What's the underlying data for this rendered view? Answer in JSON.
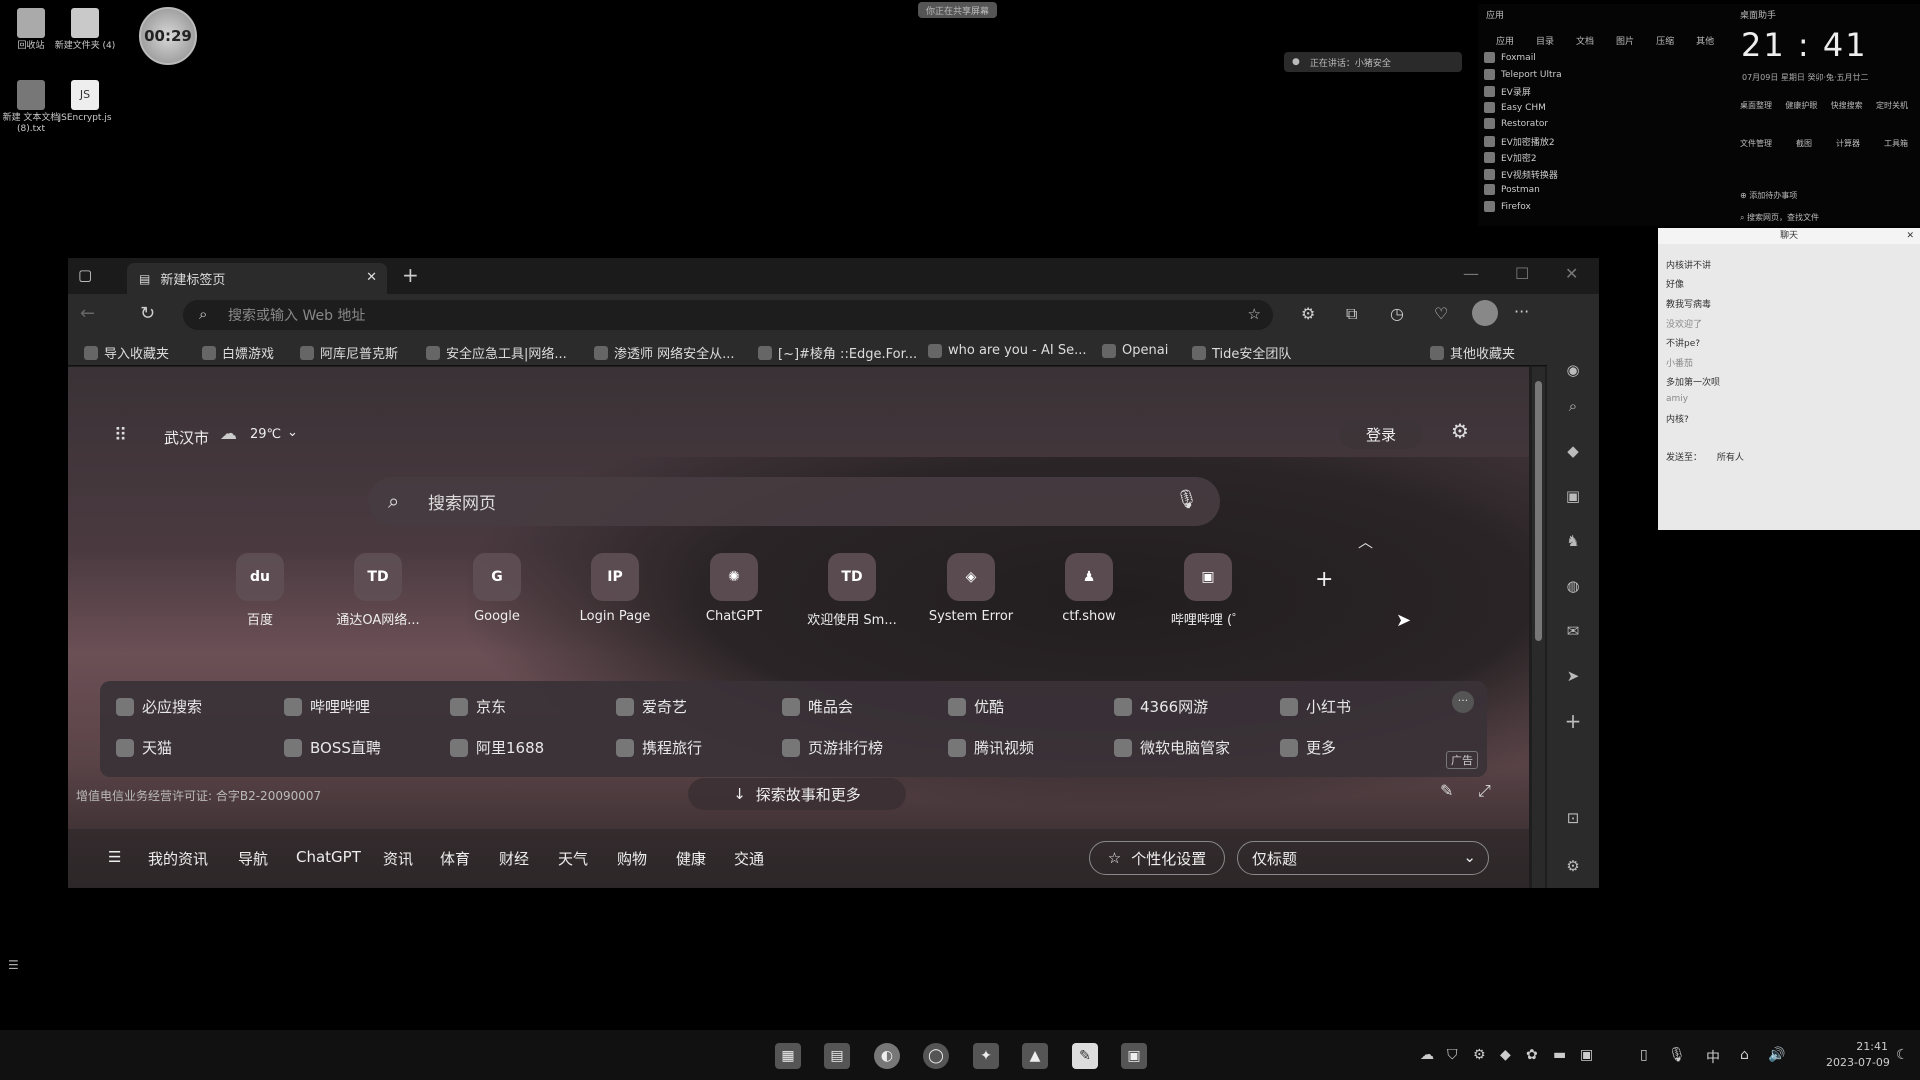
{
  "desktop": {
    "icons": [
      {
        "label": "回收站"
      },
      {
        "label": "新建文件夹 (4)"
      },
      {
        "label": "新建 文本文档 (8).txt"
      },
      {
        "label": "JSEncrypt.js"
      }
    ],
    "timer": "00:29",
    "top_notice": "你正在共享屏幕",
    "meeting_bar": "正在讲话：小猪安全"
  },
  "launcher": {
    "tabs": [
      "应用",
      "目录",
      "文档",
      "图片",
      "压缩",
      "其他"
    ],
    "header_left": "应用",
    "header_right": "桌面助手",
    "apps": [
      "Foxmail",
      "Teleport Ultra",
      "EV录屏",
      "Easy CHM",
      "Restorator",
      "EV加密播放2",
      "EV加密2",
      "EV视频转换器",
      "Postman",
      "Firefox"
    ],
    "clock": "21 : 41",
    "date_line": "07月09日   星期日   癸卯·兔·五月廿二",
    "tools_row1": [
      "桌面整理",
      "健康护眼",
      "快搜搜索",
      "定时关机"
    ],
    "tools_row2": [
      "文件管理",
      "截图",
      "计算器",
      "工具箱"
    ],
    "add_event": "添加待办事项",
    "search_hint": "搜索网页，查找文件"
  },
  "chat": {
    "title": "聊天",
    "messages": [
      "内核讲不讲",
      "好像",
      "教我写病毒",
      "没欢迎了",
      "不讲pe?",
      "小番茄",
      "多加第一次呗",
      "amiy",
      "内核?"
    ],
    "send_to_label": "发送至：",
    "send_to_value": "所有人"
  },
  "browser": {
    "tab_title": "新建标签页",
    "address_placeholder": "搜索或输入 Web 地址",
    "favorites": [
      "导入收藏夹",
      "白嫖游戏",
      "阿库尼普克斯",
      "安全应急工具|网络...",
      "渗透师 网络安全从...",
      "[~]#棱角 ::Edge.For...",
      "who are you - AI Se...",
      "Openai",
      "Tide安全团队",
      "其他收藏夹"
    ],
    "city": "武汉市",
    "temperature": "29℃",
    "login_label": "登录",
    "search_placeholder": "搜索网页",
    "quick_links": [
      {
        "label": "百度",
        "glyph": "du"
      },
      {
        "label": "通达OA网络...",
        "glyph": "TD"
      },
      {
        "label": "Google",
        "glyph": "G"
      },
      {
        "label": "Login Page",
        "glyph": "IP"
      },
      {
        "label": "ChatGPT",
        "glyph": "✺"
      },
      {
        "label": "欢迎使用 Sm...",
        "glyph": "TD"
      },
      {
        "label": "System Error",
        "glyph": "◈"
      },
      {
        "label": "ctf.show",
        "glyph": "♟"
      },
      {
        "label": "哔哩哔哩 (゜",
        "glyph": "▣"
      }
    ],
    "panel_row1": [
      "必应搜索",
      "哔哩哔哩",
      "京东",
      "爱奇艺",
      "唯品会",
      "优酷",
      "4366网游",
      "小红书"
    ],
    "panel_row2": [
      "天猫",
      "BOSS直聘",
      "阿里1688",
      "携程旅行",
      "页游排行榜",
      "腾讯视频",
      "微软电脑管家",
      "更多"
    ],
    "ad_label": "广告",
    "license": "增值电信业务经营许可证: 合字B2-20090007",
    "explore_label": "探索故事和更多",
    "news_tabs": [
      "我的资讯",
      "导航",
      "ChatGPT",
      "资讯",
      "体育",
      "财经",
      "天气",
      "购物",
      "健康",
      "交通"
    ],
    "personalize_label": "个性化设置",
    "view_select": "仅标题"
  },
  "taskbar": {
    "ime": "中",
    "time": "21:41",
    "date": "2023-07-09"
  }
}
